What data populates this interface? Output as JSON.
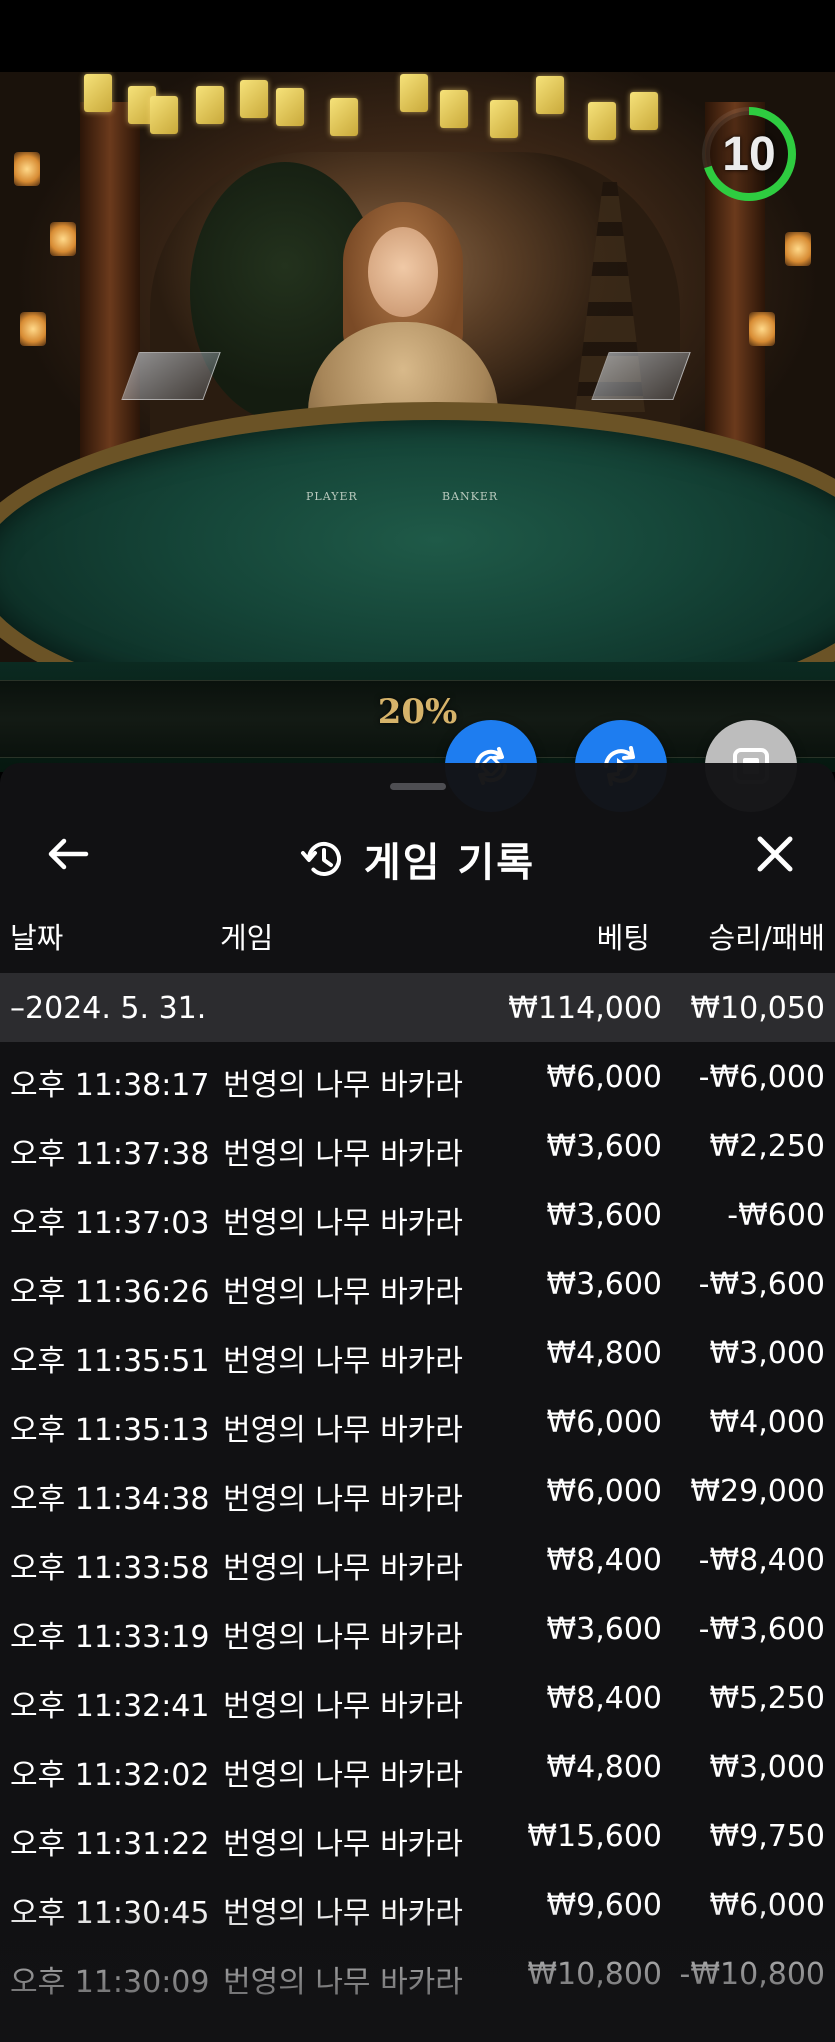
{
  "video": {
    "countdown": "10",
    "countdown_fraction": 0.7,
    "table_player_label": "PLAYER",
    "table_banker_label": "BANKER",
    "promo_text": "20%"
  },
  "actions": {
    "fab1_icon": "swap-icon",
    "fab2_icon": "replay-icon",
    "fab3_icon": "stop-icon"
  },
  "history": {
    "title": "게임 기록",
    "icon": "history-icon",
    "columns": {
      "date": "날짜",
      "game": "게임",
      "bet": "베팅",
      "winloss": "승리/패배"
    },
    "summary": {
      "date": "–2024. 5. 31.",
      "bet": "₩114,000",
      "winloss": "₩10,050"
    },
    "rows": [
      {
        "time": "오후 11:38:17",
        "game": "번영의 나무 바카라",
        "bet": "₩6,000",
        "winloss": "-₩6,000"
      },
      {
        "time": "오후 11:37:38",
        "game": "번영의 나무 바카라",
        "bet": "₩3,600",
        "winloss": "₩2,250"
      },
      {
        "time": "오후 11:37:03",
        "game": "번영의 나무 바카라",
        "bet": "₩3,600",
        "winloss": "-₩600"
      },
      {
        "time": "오후 11:36:26",
        "game": "번영의 나무 바카라",
        "bet": "₩3,600",
        "winloss": "-₩3,600"
      },
      {
        "time": "오후 11:35:51",
        "game": "번영의 나무 바카라",
        "bet": "₩4,800",
        "winloss": "₩3,000"
      },
      {
        "time": "오후 11:35:13",
        "game": "번영의 나무 바카라",
        "bet": "₩6,000",
        "winloss": "₩4,000"
      },
      {
        "time": "오후 11:34:38",
        "game": "번영의 나무 바카라",
        "bet": "₩6,000",
        "winloss": "₩29,000"
      },
      {
        "time": "오후 11:33:58",
        "game": "번영의 나무 바카라",
        "bet": "₩8,400",
        "winloss": "-₩8,400"
      },
      {
        "time": "오후 11:33:19",
        "game": "번영의 나무 바카라",
        "bet": "₩3,600",
        "winloss": "-₩3,600"
      },
      {
        "time": "오후 11:32:41",
        "game": "번영의 나무 바카라",
        "bet": "₩8,400",
        "winloss": "₩5,250"
      },
      {
        "time": "오후 11:32:02",
        "game": "번영의 나무 바카라",
        "bet": "₩4,800",
        "winloss": "₩3,000"
      },
      {
        "time": "오후 11:31:22",
        "game": "번영의 나무 바카라",
        "bet": "₩15,600",
        "winloss": "₩9,750"
      },
      {
        "time": "오후 11:30:45",
        "game": "번영의 나무 바카라",
        "bet": "₩9,600",
        "winloss": "₩6,000"
      },
      {
        "time": "오후 11:30:09",
        "game": "번영의 나무 바카라",
        "bet": "₩10,800",
        "winloss": "-₩10,800"
      }
    ]
  },
  "colors": {
    "accent_blue": "#1e7df0",
    "timer_green": "#2ecc40",
    "promo_gold": "#d6b36a"
  }
}
